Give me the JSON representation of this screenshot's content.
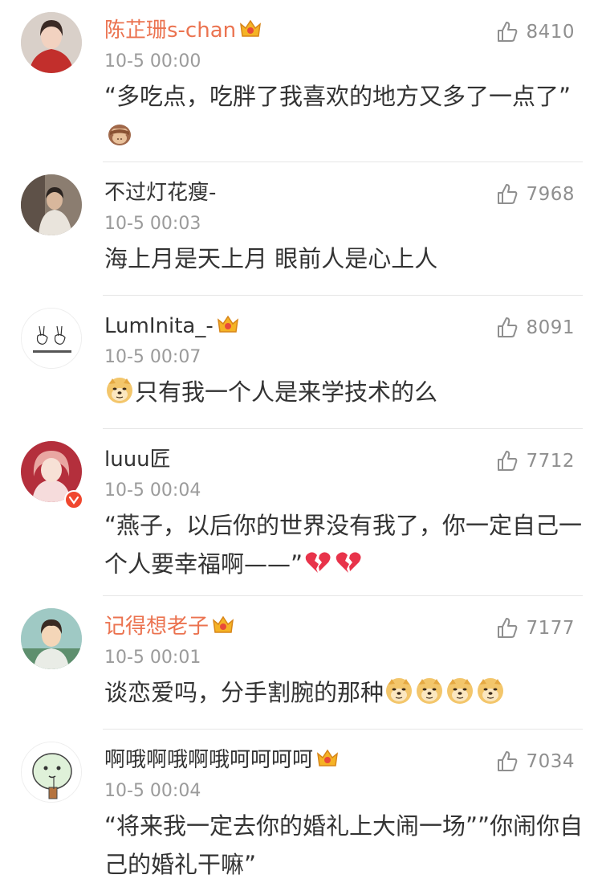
{
  "comments": [
    {
      "name": "陈芷珊s-chan",
      "vip": true,
      "time": "10-5 00:00",
      "likes": "8410",
      "text_parts": [
        "“多吃点，吃胖了我喜欢的地方又多了一点了”"
      ],
      "emoji_after": [
        "see-no-evil-monkey-emoji"
      ],
      "avatar": "avatar-woman-red-icon"
    },
    {
      "name": "不过灯花瘦-",
      "vip": false,
      "time": "10-5 00:03",
      "likes": "7968",
      "text_parts": [
        "海上月是天上月 眼前人是心上人"
      ],
      "avatar": "avatar-person-photo-icon"
    },
    {
      "name": "LumInita_-",
      "vip": true,
      "time": "10-5 00:07",
      "likes": "8091",
      "text_parts": [
        "只有我一个人是来学技术的么"
      ],
      "emoji_before": [
        "doge-emoji"
      ],
      "avatar": "avatar-sketch-rabbits-icon"
    },
    {
      "name": "luuu匠",
      "vip": false,
      "verified": true,
      "time": "10-5 00:04",
      "likes": "7712",
      "text_parts": [
        "“燕子，以后你的世界没有我了，你一定自己一个人要幸福啊——”"
      ],
      "emoji_after": [
        "broken-heart-emoji",
        "broken-heart-emoji"
      ],
      "avatar": "avatar-girl-pink-icon"
    },
    {
      "name": "记得想老子",
      "vip": true,
      "time": "10-5 00:01",
      "likes": "7177",
      "text_parts": [
        "谈恋爱吗，分手割腕的那种"
      ],
      "emoji_after": [
        "doge-emoji",
        "doge-emoji",
        "doge-emoji",
        "doge-emoji"
      ],
      "avatar": "avatar-anime-boy-icon"
    },
    {
      "name": "啊哦啊哦啊哦呵呵呵呵",
      "vip": true,
      "time": "10-5 00:04",
      "likes": "7034",
      "text_parts": [
        "“将来我一定去你的婚礼上大闹一场””你闹你自己的婚礼干嘛”"
      ],
      "avatar": "avatar-cartoon-drink-icon"
    }
  ],
  "colors": {
    "vip_name": "#eb7350",
    "name": "#333333",
    "meta": "#9b9b9b",
    "divider": "#e6e6e6"
  },
  "icons": {
    "like": "thumbs-up-icon",
    "vip": "vip-crown-icon",
    "verified": "verified-v-icon"
  }
}
